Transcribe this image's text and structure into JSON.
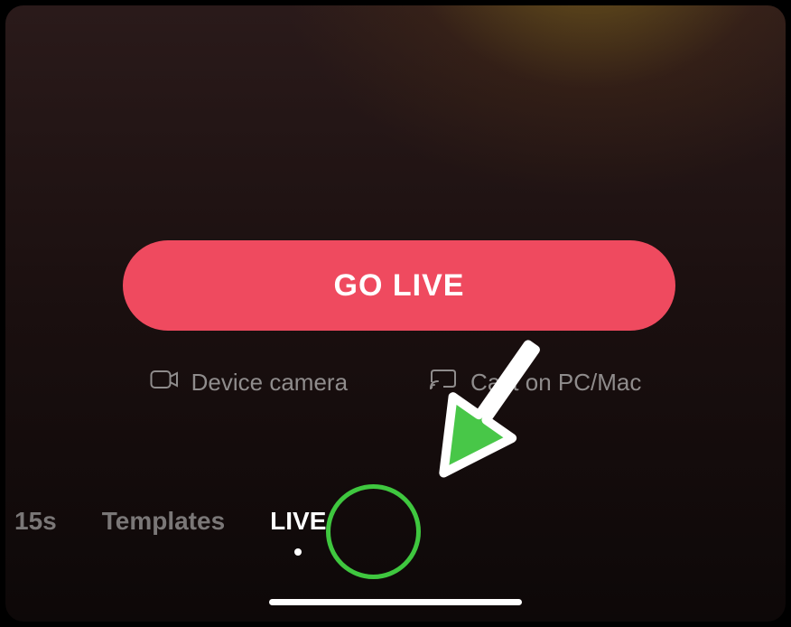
{
  "goLive": {
    "label": "GO LIVE"
  },
  "sources": {
    "deviceCamera": {
      "label": "Device camera"
    },
    "castPcMac": {
      "label": "Cast on PC/Mac"
    }
  },
  "tabs": {
    "fifteenSec": {
      "label": "15s"
    },
    "templates": {
      "label": "Templates"
    },
    "live": {
      "label": "LIVE",
      "active": true
    }
  },
  "colors": {
    "accent": "#ef4a5f",
    "annotation": "#3fc73f"
  }
}
